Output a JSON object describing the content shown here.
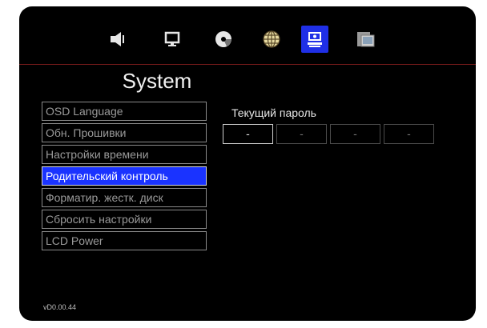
{
  "icons": [
    {
      "name": "speaker-icon",
      "selected": false
    },
    {
      "name": "monitor-icon",
      "selected": false
    },
    {
      "name": "disc-icon",
      "selected": false
    },
    {
      "name": "globe-icon",
      "selected": false
    },
    {
      "name": "computer-settings-icon",
      "selected": true
    },
    {
      "name": "photo-media-icon",
      "selected": false
    }
  ],
  "page": {
    "title": "System"
  },
  "menu": {
    "items": [
      {
        "label": "OSD Language"
      },
      {
        "label": "Обн. Прошивки"
      },
      {
        "label": "Настройки времени"
      },
      {
        "label": "Родительский контроль"
      },
      {
        "label": "Форматир. жестк. диск"
      },
      {
        "label": "Сбросить настройки"
      },
      {
        "label": "LCD Power"
      }
    ],
    "active_index": 3
  },
  "password": {
    "label": "Текущий пароль",
    "digits": [
      "-",
      "-",
      "-",
      "-"
    ]
  },
  "footer": {
    "version": "vD0.00.44"
  },
  "colors": {
    "background": "#000000",
    "selection_blue": "#1a33ff",
    "divider_red": "#8a1f1f"
  }
}
